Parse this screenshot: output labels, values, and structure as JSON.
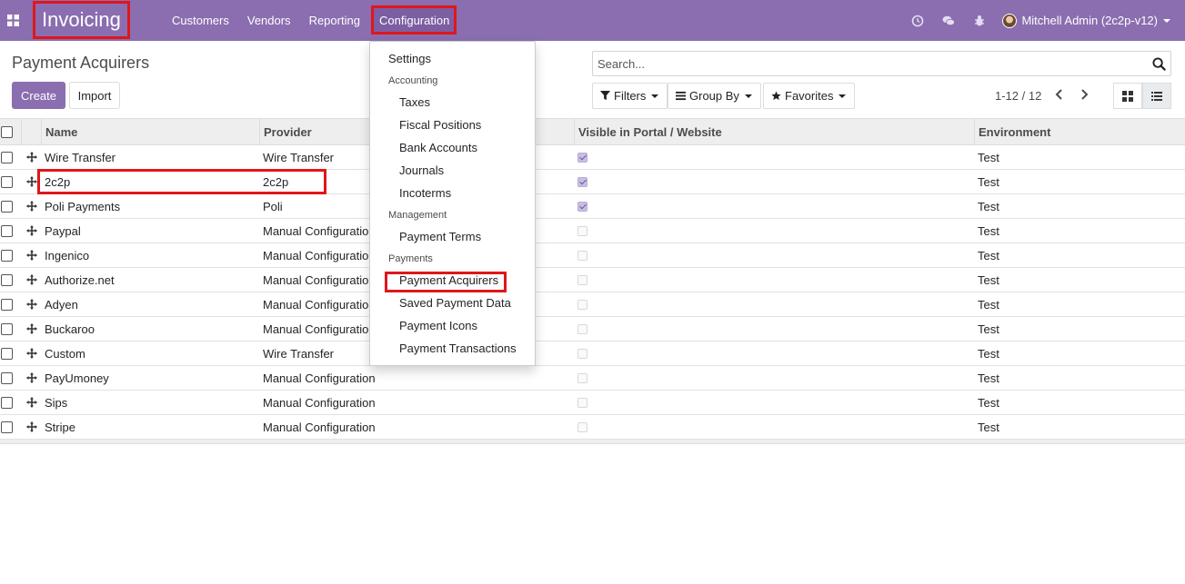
{
  "navbar": {
    "app_title": "Invoicing",
    "menu": [
      "Customers",
      "Vendors",
      "Reporting",
      "Configuration"
    ],
    "user": "Mitchell Admin (2c2p-v12)",
    "icons": [
      "apps-icon",
      "clock-icon",
      "chat-icon",
      "bug-icon"
    ]
  },
  "control_panel": {
    "title": "Payment Acquirers",
    "create_label": "Create",
    "import_label": "Import",
    "search_placeholder": "Search...",
    "filters_label": "Filters",
    "groupby_label": "Group By",
    "favorites_label": "Favorites",
    "pager": "1-12 / 12"
  },
  "table": {
    "columns": [
      "Name",
      "Provider",
      "Visible in Portal / Website",
      "Environment"
    ],
    "rows": [
      {
        "name": "Wire Transfer",
        "provider": "Wire Transfer",
        "visible": true,
        "environment": "Test"
      },
      {
        "name": "2c2p",
        "provider": "2c2p",
        "visible": true,
        "environment": "Test"
      },
      {
        "name": "Poli Payments",
        "provider": "Poli",
        "visible": true,
        "environment": "Test"
      },
      {
        "name": "Paypal",
        "provider": "Manual Configuration",
        "visible": false,
        "environment": "Test"
      },
      {
        "name": "Ingenico",
        "provider": "Manual Configuration",
        "visible": false,
        "environment": "Test"
      },
      {
        "name": "Authorize.net",
        "provider": "Manual Configuration",
        "visible": false,
        "environment": "Test"
      },
      {
        "name": "Adyen",
        "provider": "Manual Configuration",
        "visible": false,
        "environment": "Test"
      },
      {
        "name": "Buckaroo",
        "provider": "Manual Configuration",
        "visible": false,
        "environment": "Test"
      },
      {
        "name": "Custom",
        "provider": "Wire Transfer",
        "visible": false,
        "environment": "Test"
      },
      {
        "name": "PayUmoney",
        "provider": "Manual Configuration",
        "visible": false,
        "environment": "Test"
      },
      {
        "name": "Sips",
        "provider": "Manual Configuration",
        "visible": false,
        "environment": "Test"
      },
      {
        "name": "Stripe",
        "provider": "Manual Configuration",
        "visible": false,
        "environment": "Test"
      }
    ]
  },
  "config_dropdown": {
    "settings": "Settings",
    "sections": [
      {
        "header": "Accounting",
        "items": [
          "Taxes",
          "Fiscal Positions",
          "Bank Accounts",
          "Journals",
          "Incoterms"
        ]
      },
      {
        "header": "Management",
        "items": [
          "Payment Terms"
        ]
      },
      {
        "header": "Payments",
        "items": [
          "Payment Acquirers",
          "Saved Payment Data",
          "Payment Icons",
          "Payment Transactions"
        ]
      }
    ]
  },
  "colors": {
    "navbar": "#8a6eb0",
    "primary": "#8a6eb0",
    "highlight": "#e0161b"
  }
}
